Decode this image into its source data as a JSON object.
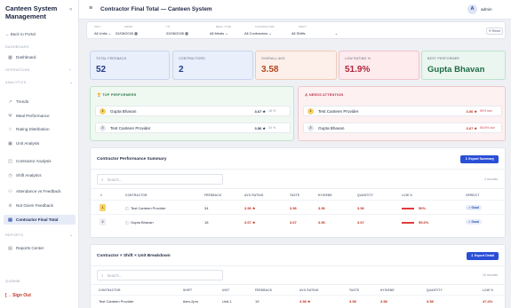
{
  "app": {
    "title": "Canteen System Management",
    "collapse_icon": "«"
  },
  "sidebar": {
    "back": "← Back to Portal",
    "sections": {
      "dashboard": "DASHBOARD",
      "operations": "OPERATIONS",
      "analytics": "ANALYTICS",
      "reports": "REPORTS",
      "admin": "ADMIN"
    },
    "items": [
      {
        "label": "Dashboard",
        "icon": "grid-icon"
      },
      {
        "label": "Trends",
        "icon": "trend-icon"
      },
      {
        "label": "Meal Performance",
        "icon": "meal-icon"
      },
      {
        "label": "Rating Distribution",
        "icon": "star-icon"
      },
      {
        "label": "Unit Analysis",
        "icon": "building-icon"
      },
      {
        "label": "Contractor Analysis",
        "icon": "briefcase-icon"
      },
      {
        "label": "Shift Analytics",
        "icon": "clock-icon"
      },
      {
        "label": "Attendance vs Feedback",
        "icon": "people-icon"
      },
      {
        "label": "Not Given Feedback",
        "icon": "ban-icon"
      },
      {
        "label": "Contractor Final Total",
        "icon": "document-icon"
      },
      {
        "label": "Reports Center",
        "icon": "report-icon"
      }
    ],
    "signout": "Sign Out"
  },
  "topbar": {
    "title": "Contractor Final Total — Canteen System",
    "avatar": "A",
    "user": "admin"
  },
  "filters": {
    "unit": {
      "label": "UNIT",
      "value": "All Units"
    },
    "from": {
      "label": "FROM",
      "value": "02/08/2026"
    },
    "to": {
      "label": "TO",
      "value": "02/08/2026"
    },
    "meal": {
      "label": "MEAL TYPE",
      "value": "All Meals"
    },
    "contractor": {
      "label": "CONTRACTOR",
      "value": "All Contractors"
    },
    "shift": {
      "label": "SHIFT",
      "value": "All Shifts"
    },
    "reset": "⟲ Reset"
  },
  "kpis": [
    {
      "label": "TOTAL FEEDBACK",
      "value": "52"
    },
    {
      "label": "CONTRACTORS",
      "value": "2"
    },
    {
      "label": "OVERALL AVG",
      "value": "3.58"
    },
    {
      "label": "LOW RATING %",
      "value": "51.9%"
    },
    {
      "label": "BEST PERFORMER",
      "value": "Gupta Bhavan"
    }
  ],
  "top_performers": {
    "title": "🏆 TOP PERFORMERS",
    "rows": [
      {
        "rank": "1",
        "name": "Gupta Bhavan",
        "rating": "3.67 ★",
        "pct": "18 %"
      },
      {
        "rank": "2",
        "name": "Test Canteen Provider",
        "rating": "3.56 ★",
        "pct": "34 %"
      }
    ]
  },
  "needs_attention": {
    "title": "⚠ NEEDS ATTENTION",
    "rows": [
      {
        "rank": "1",
        "name": "Test Canteen Provider",
        "rating": "3.56 ★",
        "pct": "50% low"
      },
      {
        "rank": "2",
        "name": "Gupta Bhavan",
        "rating": "3.67 ★",
        "pct": "55.6% low"
      }
    ]
  },
  "summary": {
    "title": "Contractor Performance Summary",
    "export": "⇩ Export Summary",
    "search_placeholder": "Search...",
    "records": "2 records",
    "headers": [
      "#",
      "CONTRACTOR",
      "FEEDBACK",
      "AVG RATING",
      "TASTE",
      "HYGIENE",
      "QUANTITY",
      "LOW %",
      "VERDICT"
    ],
    "rows": [
      {
        "rank": "1",
        "contractor": "Test Canteen Provider",
        "feedback": "34",
        "avg": "3.56 ★",
        "taste": "3.56",
        "hygiene": "3.56",
        "quantity": "3.56",
        "low": "50%",
        "verdict": "✓ Good"
      },
      {
        "rank": "2",
        "contractor": "Gupta Bhavan",
        "feedback": "18",
        "avg": "3.67 ★",
        "taste": "3.67",
        "hygiene": "3.56",
        "quantity": "3.67",
        "low": "55.6%",
        "verdict": "✓ Good"
      }
    ]
  },
  "breakdown": {
    "title": "Contractor × Shift × Unit Breakdown",
    "export": "⇩ Export Detail",
    "search_placeholder": "Search...",
    "records": "10 records",
    "headers": [
      "CONTRACTOR",
      "SHIFT",
      "UNIT",
      "FEEDBACK",
      "AVG RATING",
      "TASTE",
      "HYGIENE",
      "QUANTITY",
      "LOW %"
    ],
    "rows": [
      {
        "contractor": "Test Canteen Provider",
        "shift": "6am-2pm",
        "unit": "Unit-1",
        "feedback": "19",
        "avg": "3.58 ★",
        "taste": "3.58",
        "hygiene": "3.58",
        "quantity": "3.58",
        "low": "47.4%"
      }
    ]
  },
  "colors": {
    "accent": "#2a4fd6",
    "danger": "#c2331f",
    "success": "#2d7a4b"
  }
}
